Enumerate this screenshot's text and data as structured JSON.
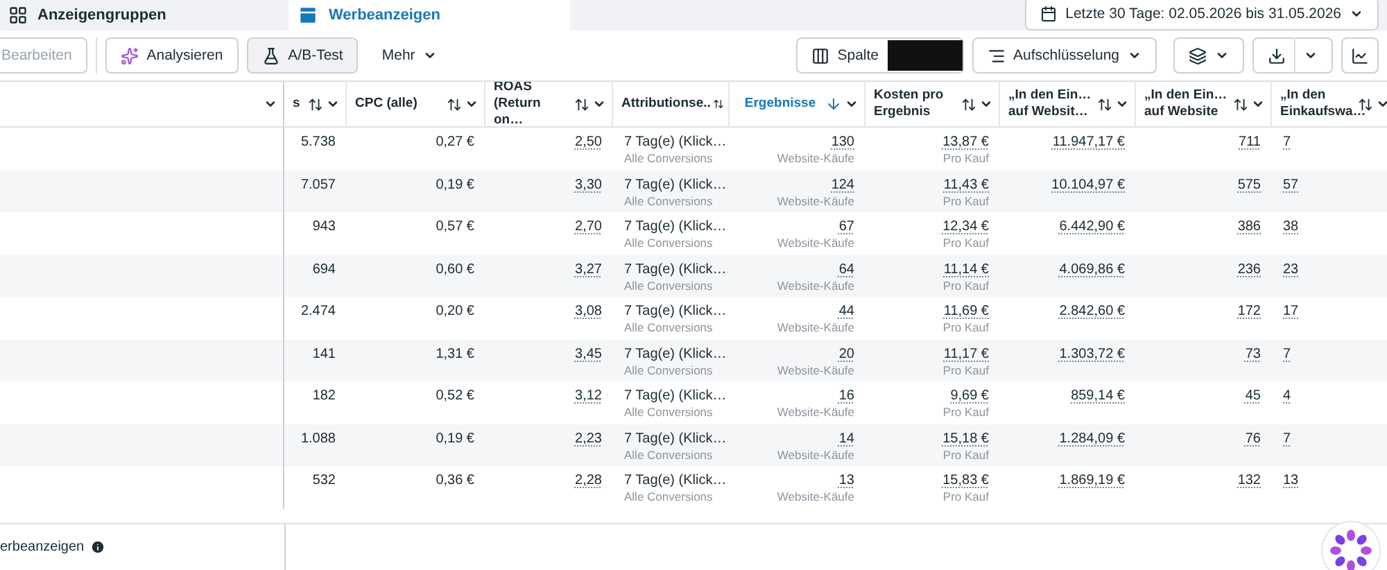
{
  "tabs": [
    {
      "label": "Anzeigengruppen",
      "selected": false
    },
    {
      "label": "Werbeanzeigen",
      "selected": true
    }
  ],
  "date_range": "Letzte 30 Tage: 02.05.2026 bis 31.05.2026",
  "toolbar_left": [
    {
      "kind": "disabled",
      "label": "Bearbeiten"
    },
    {
      "kind": "analyze",
      "label": "Analysieren"
    },
    {
      "kind": "abtest",
      "label": "A/B-Test"
    },
    {
      "kind": "menu",
      "label": "Mehr"
    }
  ],
  "toolbar_right": {
    "columns": "Spalte",
    "breakdown": "Aufschlüsselung"
  },
  "columns": [
    {
      "label": "s",
      "sorted": false
    },
    {
      "label": "CPC (alle)",
      "sorted": false
    },
    {
      "label": "ROAS (Return on…",
      "sorted": false
    },
    {
      "label": "Attributionse..",
      "sorted": false
    },
    {
      "label": "Ergebnisse",
      "sorted": true
    },
    {
      "label": "Kosten pro Ergebnis",
      "sorted": false
    },
    {
      "label": "„In den Ein… auf Websit…",
      "sorted": false
    },
    {
      "label": "„In den Ein… auf Website",
      "sorted": false
    },
    {
      "label": "„In den Einkaufswa…",
      "sorted": false
    }
  ],
  "rows": [
    {
      "column_1": "5.738",
      "cpc": "0,27 €",
      "roas": "2,50",
      "attribution": "7 Tag(e) (Klick…",
      "attribution_note": "Alle Conversions",
      "results": "130",
      "results_note": "Website-Käufe",
      "cost": "13,87 €",
      "cost_note": "Pro Kauf",
      "value": "11.947,17 €",
      "purchases": "711",
      "column_9": "7"
    },
    {
      "column_1": "7.057",
      "cpc": "0,19 €",
      "roas": "3,30",
      "attribution": "7 Tag(e) (Klick…",
      "attribution_note": "Alle Conversions",
      "results": "124",
      "results_note": "Website-Käufe",
      "cost": "11,43 €",
      "cost_note": "Pro Kauf",
      "value": "10.104,97 €",
      "purchases": "575",
      "column_9": "57"
    },
    {
      "column_1": "943",
      "cpc": "0,57 €",
      "roas": "2,70",
      "attribution": "7 Tag(e) (Klick…",
      "attribution_note": "Alle Conversions",
      "results": "67",
      "results_note": "Website-Käufe",
      "cost": "12,34 €",
      "cost_note": "Pro Kauf",
      "value": "6.442,90 €",
      "purchases": "386",
      "column_9": "38"
    },
    {
      "column_1": "694",
      "cpc": "0,60 €",
      "roas": "3,27",
      "attribution": "7 Tag(e) (Klick…",
      "attribution_note": "Alle Conversions",
      "results": "64",
      "results_note": "Website-Käufe",
      "cost": "11,14 €",
      "cost_note": "Pro Kauf",
      "value": "4.069,86 €",
      "purchases": "236",
      "column_9": "23"
    },
    {
      "column_1": "2.474",
      "cpc": "0,20 €",
      "roas": "3,08",
      "attribution": "7 Tag(e) (Klick…",
      "attribution_note": "Alle Conversions",
      "results": "44",
      "results_note": "Website-Käufe",
      "cost": "11,69 €",
      "cost_note": "Pro Kauf",
      "value": "2.842,60 €",
      "purchases": "172",
      "column_9": "17"
    },
    {
      "column_1": "141",
      "cpc": "1,31 €",
      "roas": "3,45",
      "attribution": "7 Tag(e) (Klick…",
      "attribution_note": "Alle Conversions",
      "results": "20",
      "results_note": "Website-Käufe",
      "cost": "11,17 €",
      "cost_note": "Pro Kauf",
      "value": "1.303,72 €",
      "purchases": "73",
      "column_9": "7"
    },
    {
      "column_1": "182",
      "cpc": "0,52 €",
      "roas": "3,12",
      "attribution": "7 Tag(e) (Klick…",
      "attribution_note": "Alle Conversions",
      "results": "16",
      "results_note": "Website-Käufe",
      "cost": "9,69 €",
      "cost_note": "Pro Kauf",
      "value": "859,14 €",
      "purchases": "45",
      "column_9": "4"
    },
    {
      "column_1": "1.088",
      "cpc": "0,19 €",
      "roas": "2,23",
      "attribution": "7 Tag(e) (Klick…",
      "attribution_note": "Alle Conversions",
      "results": "14",
      "results_note": "Website-Käufe",
      "cost": "15,18 €",
      "cost_note": "Pro Kauf",
      "value": "1.284,09 €",
      "purchases": "76",
      "column_9": "7"
    },
    {
      "column_1": "532",
      "cpc": "0,36 €",
      "roas": "2,28",
      "attribution": "7 Tag(e) (Klick…",
      "attribution_note": "Alle Conversions",
      "results": "13",
      "results_note": "Website-Käufe",
      "cost": "15,83 €",
      "cost_note": "Pro Kauf",
      "value": "1.869,19 €",
      "purchases": "132",
      "column_9": "13"
    }
  ],
  "footer": "erbeanzeigen"
}
